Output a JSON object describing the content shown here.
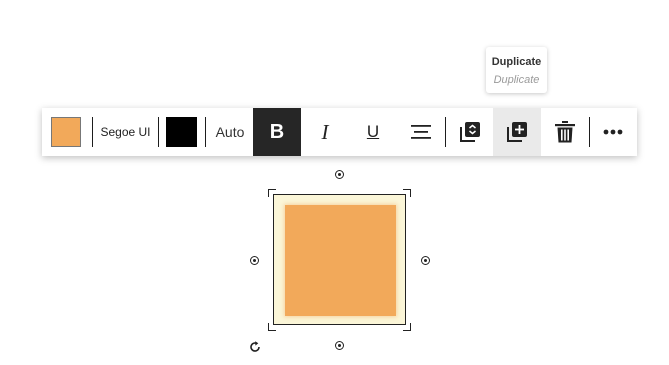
{
  "tooltip": {
    "title": "Duplicate",
    "subtitle": "Duplicate"
  },
  "toolbar": {
    "fill_color": "#f2a95a",
    "font_family": "Segoe UI",
    "font_color": "#000000",
    "font_size": "Auto",
    "bold_label": "B",
    "italic_label": "I",
    "underline_label": "U",
    "bold_active": true,
    "icons": {
      "align": "align-center-icon",
      "arrange": "arrange-layers-icon",
      "duplicate": "duplicate-icon",
      "delete": "trash-icon",
      "more": "more-options-icon"
    }
  },
  "selection": {
    "shape_color": "#f2a95a",
    "frame_color": "#fbf6d8"
  }
}
